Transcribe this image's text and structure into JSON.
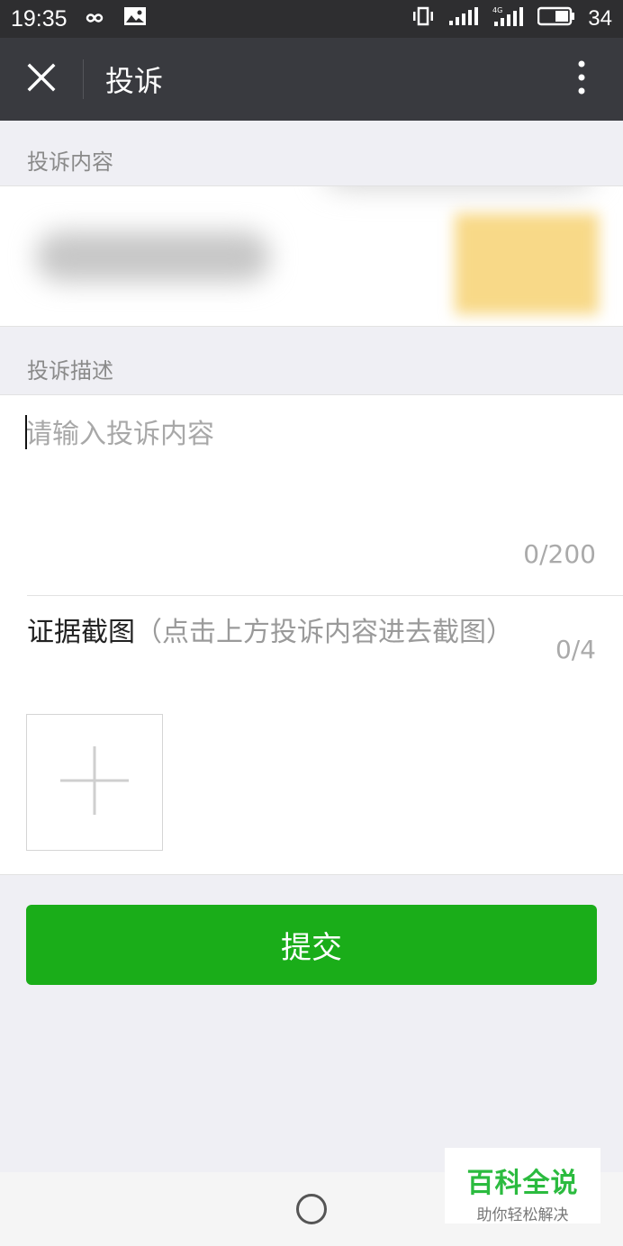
{
  "status_bar": {
    "time": "19:35",
    "battery": "34",
    "network": "4G"
  },
  "header": {
    "title": "投诉"
  },
  "complaint_content": {
    "label": "投诉内容"
  },
  "description": {
    "label": "投诉描述",
    "placeholder": "请输入投诉内容",
    "char_count": "0/200"
  },
  "evidence": {
    "title": "证据截图",
    "hint": "（点击上方投诉内容进去截图）",
    "count": "0/4"
  },
  "submit": {
    "label": "提交"
  },
  "watermark": {
    "main": "百科全说",
    "sub": "助你轻松解决"
  },
  "colors": {
    "accent": "#1aad19",
    "title_bar": "#393a3f",
    "background": "#efeff4"
  }
}
